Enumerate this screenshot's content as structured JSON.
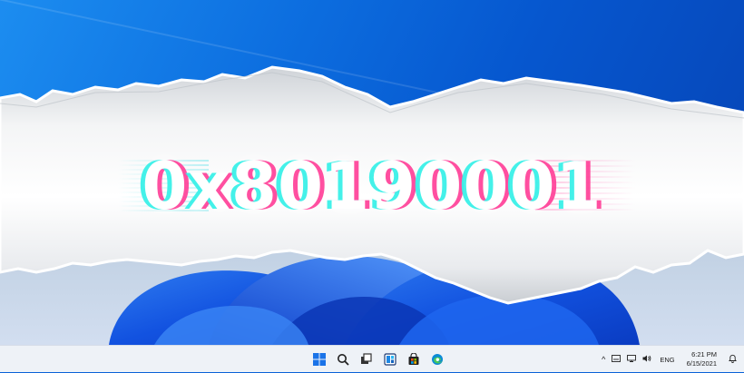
{
  "headline": {
    "error_code": "0x80190001"
  },
  "taskbar": {
    "pinned": [
      {
        "name": "start-button-icon"
      },
      {
        "name": "search-icon"
      },
      {
        "name": "task-view-icon"
      },
      {
        "name": "widgets-icon"
      },
      {
        "name": "store-icon"
      },
      {
        "name": "edge-icon"
      }
    ],
    "tray": {
      "language": "ENG",
      "time": "6:21 PM",
      "date": "6/15/2021"
    }
  },
  "colors": {
    "win10_blue": "#0a62d8",
    "win11_bloom": "#1560e8",
    "glitch_cyan": "#3af0e8",
    "glitch_pink": "#ff3c96"
  }
}
